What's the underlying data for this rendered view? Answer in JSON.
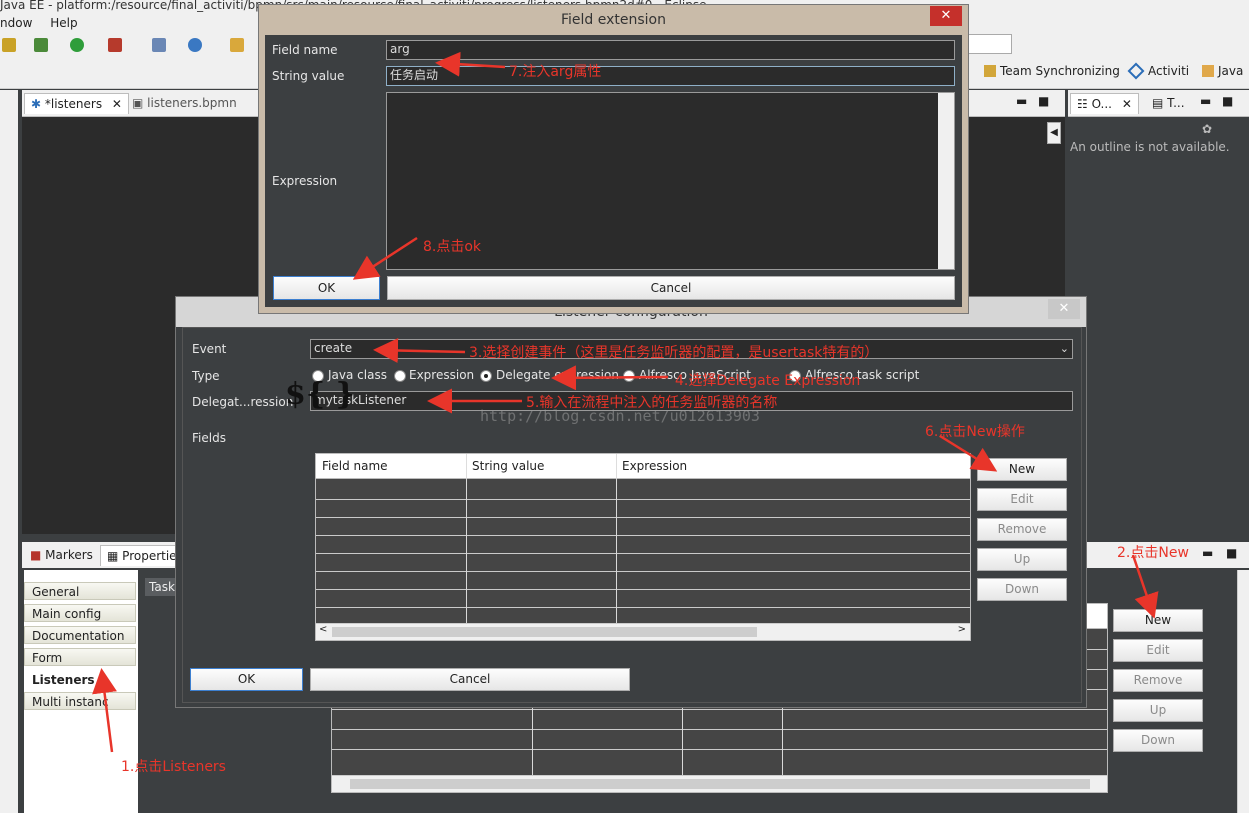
{
  "window": {
    "title": "Java EE - platform:/resource/final_activiti/bpmn/src/main/resource/final_activiti/progress/listeners.bpmn2d#0 - Eclipse"
  },
  "menu": [
    "ndow",
    "Help"
  ],
  "perspectives": [
    "Team Synchronizing",
    "Activiti",
    "Java"
  ],
  "editor_tabs": [
    {
      "label": "*listeners"
    },
    {
      "label": "listeners.bpmn"
    }
  ],
  "outline": {
    "tabs": [
      "O...",
      "T..."
    ],
    "message": "An outline is not available."
  },
  "bottom": {
    "tabs": [
      "Markers",
      "Propertie"
    ],
    "nav": [
      "General",
      "Main config",
      "Documentation",
      "Form",
      "Listeners",
      "Multi instanc"
    ],
    "selected_nav": "Listeners",
    "task_label": "Task",
    "buttons": [
      "New",
      "Edit",
      "Remove",
      "Up",
      "Down"
    ]
  },
  "field_extension": {
    "title": "Field extension",
    "field_name_label": "Field name",
    "field_name": "arg",
    "string_value_label": "String value",
    "string_value": "任务启动",
    "expression_label": "Expression",
    "ok": "OK",
    "cancel": "Cancel"
  },
  "listener_config": {
    "title": "Listener configuration",
    "event_label": "Event",
    "event": "create",
    "type_label": "Type",
    "types": [
      "Java class",
      "Expression",
      "Delegate expression",
      "Alfresco JavaScript",
      "Alfresco task script"
    ],
    "selected_type": "Delegate expression",
    "delegate_label": "Delegat...ression",
    "delegate_value": "mytaskListener",
    "fields_label": "Fields",
    "columns": [
      "Field name",
      "String value",
      "Expression"
    ],
    "buttons": [
      "New",
      "Edit",
      "Remove",
      "Up",
      "Down"
    ],
    "ok": "OK",
    "cancel": "Cancel"
  },
  "watermark": "http://blog.csdn.net/u012613903",
  "annotations": {
    "a1": "1.点击Listeners",
    "a2": "2.点击New",
    "a3": "3.选择创建事件（这里是任务监听器的配置，是usertask特有的）",
    "a4": "4.选择Delegate Expression",
    "a5": "5.输入在流程中注入的任务监听器的名称",
    "a6": "6.点击New操作",
    "a7": "7.注入arg属性",
    "a8": "8.点击ok",
    "brace": "${ }"
  },
  "colors": {
    "annotation": "#e8352a",
    "dialog_bg": "#3c3f41",
    "title_bar": "#c9bba9",
    "close": "#c5302b"
  }
}
